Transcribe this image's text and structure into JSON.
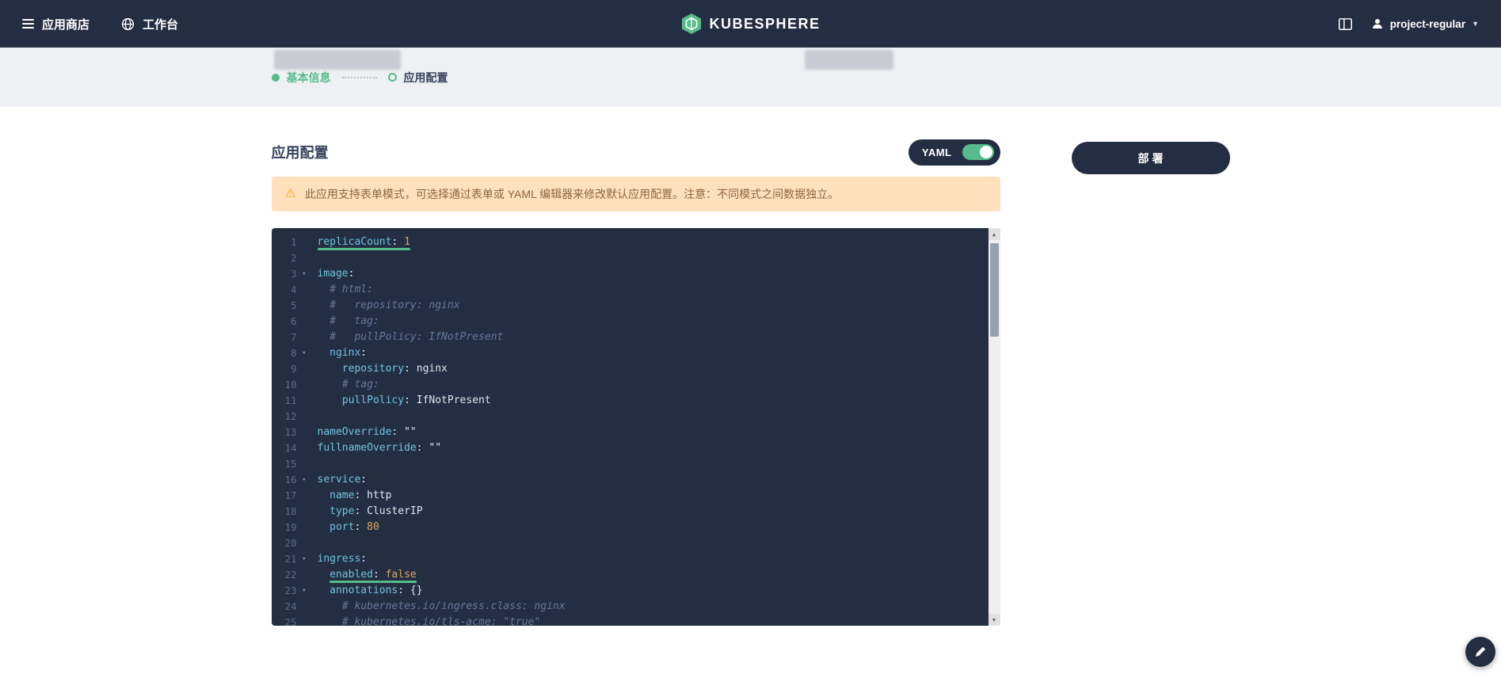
{
  "topbar": {
    "app_store": "应用商店",
    "workbench": "工作台",
    "logo_text": "KUBESPHERE",
    "user_name": "project-regular"
  },
  "steps": {
    "step1": "基本信息",
    "step2": "应用配置"
  },
  "main": {
    "title": "应用配置",
    "yaml_label": "YAML",
    "deploy_label": "部署",
    "warning_text": "此应用支持表单模式，可选择通过表单或 YAML 编辑器来修改默认应用配置。注意：不同模式之间数据独立。"
  },
  "colors": {
    "accent_green": "#55bc8a",
    "topbar_bg": "#242e42",
    "editor_bg": "#242e42",
    "warning_bg": "#ffe1be",
    "warning_text": "#8d663e",
    "key_color": "#6fc3df",
    "comment_color": "#66789a"
  },
  "editor": {
    "lines": [
      {
        "num": 1,
        "indent": "",
        "fold": false,
        "underline": true,
        "tokens": [
          [
            "k",
            "replicaCount"
          ],
          [
            "p",
            ": "
          ],
          [
            "n",
            "1"
          ]
        ]
      },
      {
        "num": 2,
        "indent": "",
        "fold": false,
        "underline": false,
        "tokens": []
      },
      {
        "num": 3,
        "indent": "",
        "fold": true,
        "underline": false,
        "tokens": [
          [
            "k",
            "image"
          ],
          [
            "p",
            ":"
          ]
        ]
      },
      {
        "num": 4,
        "indent": "  ",
        "fold": false,
        "underline": false,
        "tokens": [
          [
            "c",
            "# html:"
          ]
        ]
      },
      {
        "num": 5,
        "indent": "  ",
        "fold": false,
        "underline": false,
        "tokens": [
          [
            "c",
            "#   repository: nginx"
          ]
        ]
      },
      {
        "num": 6,
        "indent": "  ",
        "fold": false,
        "underline": false,
        "tokens": [
          [
            "c",
            "#   tag:"
          ]
        ]
      },
      {
        "num": 7,
        "indent": "  ",
        "fold": false,
        "underline": false,
        "tokens": [
          [
            "c",
            "#   pullPolicy: IfNotPresent"
          ]
        ]
      },
      {
        "num": 8,
        "indent": "  ",
        "fold": true,
        "underline": false,
        "tokens": [
          [
            "k",
            "nginx"
          ],
          [
            "p",
            ":"
          ]
        ]
      },
      {
        "num": 9,
        "indent": "    ",
        "fold": false,
        "underline": false,
        "tokens": [
          [
            "k",
            "repository"
          ],
          [
            "p",
            ": "
          ],
          [
            "s",
            "nginx"
          ]
        ]
      },
      {
        "num": 10,
        "indent": "    ",
        "fold": false,
        "underline": false,
        "tokens": [
          [
            "c",
            "# tag:"
          ]
        ]
      },
      {
        "num": 11,
        "indent": "    ",
        "fold": false,
        "underline": false,
        "tokens": [
          [
            "k",
            "pullPolicy"
          ],
          [
            "p",
            ": "
          ],
          [
            "s",
            "IfNotPresent"
          ]
        ]
      },
      {
        "num": 12,
        "indent": "",
        "fold": false,
        "underline": false,
        "tokens": []
      },
      {
        "num": 13,
        "indent": "",
        "fold": false,
        "underline": false,
        "tokens": [
          [
            "k",
            "nameOverride"
          ],
          [
            "p",
            ": "
          ],
          [
            "s",
            "\"\""
          ]
        ]
      },
      {
        "num": 14,
        "indent": "",
        "fold": false,
        "underline": false,
        "tokens": [
          [
            "k",
            "fullnameOverride"
          ],
          [
            "p",
            ": "
          ],
          [
            "s",
            "\"\""
          ]
        ]
      },
      {
        "num": 15,
        "indent": "",
        "fold": false,
        "underline": false,
        "tokens": []
      },
      {
        "num": 16,
        "indent": "",
        "fold": true,
        "underline": false,
        "tokens": [
          [
            "k",
            "service"
          ],
          [
            "p",
            ":"
          ]
        ]
      },
      {
        "num": 17,
        "indent": "  ",
        "fold": false,
        "underline": false,
        "tokens": [
          [
            "k",
            "name"
          ],
          [
            "p",
            ": "
          ],
          [
            "s",
            "http"
          ]
        ]
      },
      {
        "num": 18,
        "indent": "  ",
        "fold": false,
        "underline": false,
        "tokens": [
          [
            "k",
            "type"
          ],
          [
            "p",
            ": "
          ],
          [
            "s",
            "ClusterIP"
          ]
        ]
      },
      {
        "num": 19,
        "indent": "  ",
        "fold": false,
        "underline": false,
        "tokens": [
          [
            "k",
            "port"
          ],
          [
            "p",
            ": "
          ],
          [
            "n",
            "80"
          ]
        ]
      },
      {
        "num": 20,
        "indent": "",
        "fold": false,
        "underline": false,
        "tokens": []
      },
      {
        "num": 21,
        "indent": "",
        "fold": true,
        "underline": false,
        "tokens": [
          [
            "k",
            "ingress"
          ],
          [
            "p",
            ":"
          ]
        ]
      },
      {
        "num": 22,
        "indent": "  ",
        "fold": false,
        "underline": true,
        "tokens": [
          [
            "k",
            "enabled"
          ],
          [
            "p",
            ": "
          ],
          [
            "b",
            "false"
          ]
        ]
      },
      {
        "num": 23,
        "indent": "  ",
        "fold": true,
        "underline": false,
        "tokens": [
          [
            "k",
            "annotations"
          ],
          [
            "p",
            ": "
          ],
          [
            "p",
            "{}"
          ]
        ]
      },
      {
        "num": 24,
        "indent": "    ",
        "fold": false,
        "underline": false,
        "tokens": [
          [
            "c",
            "# kubernetes.io/ingress.class: nginx"
          ]
        ]
      },
      {
        "num": 25,
        "indent": "    ",
        "fold": false,
        "underline": false,
        "tokens": [
          [
            "c",
            "# kubernetes.io/tls-acme: \"true\""
          ]
        ]
      }
    ]
  }
}
